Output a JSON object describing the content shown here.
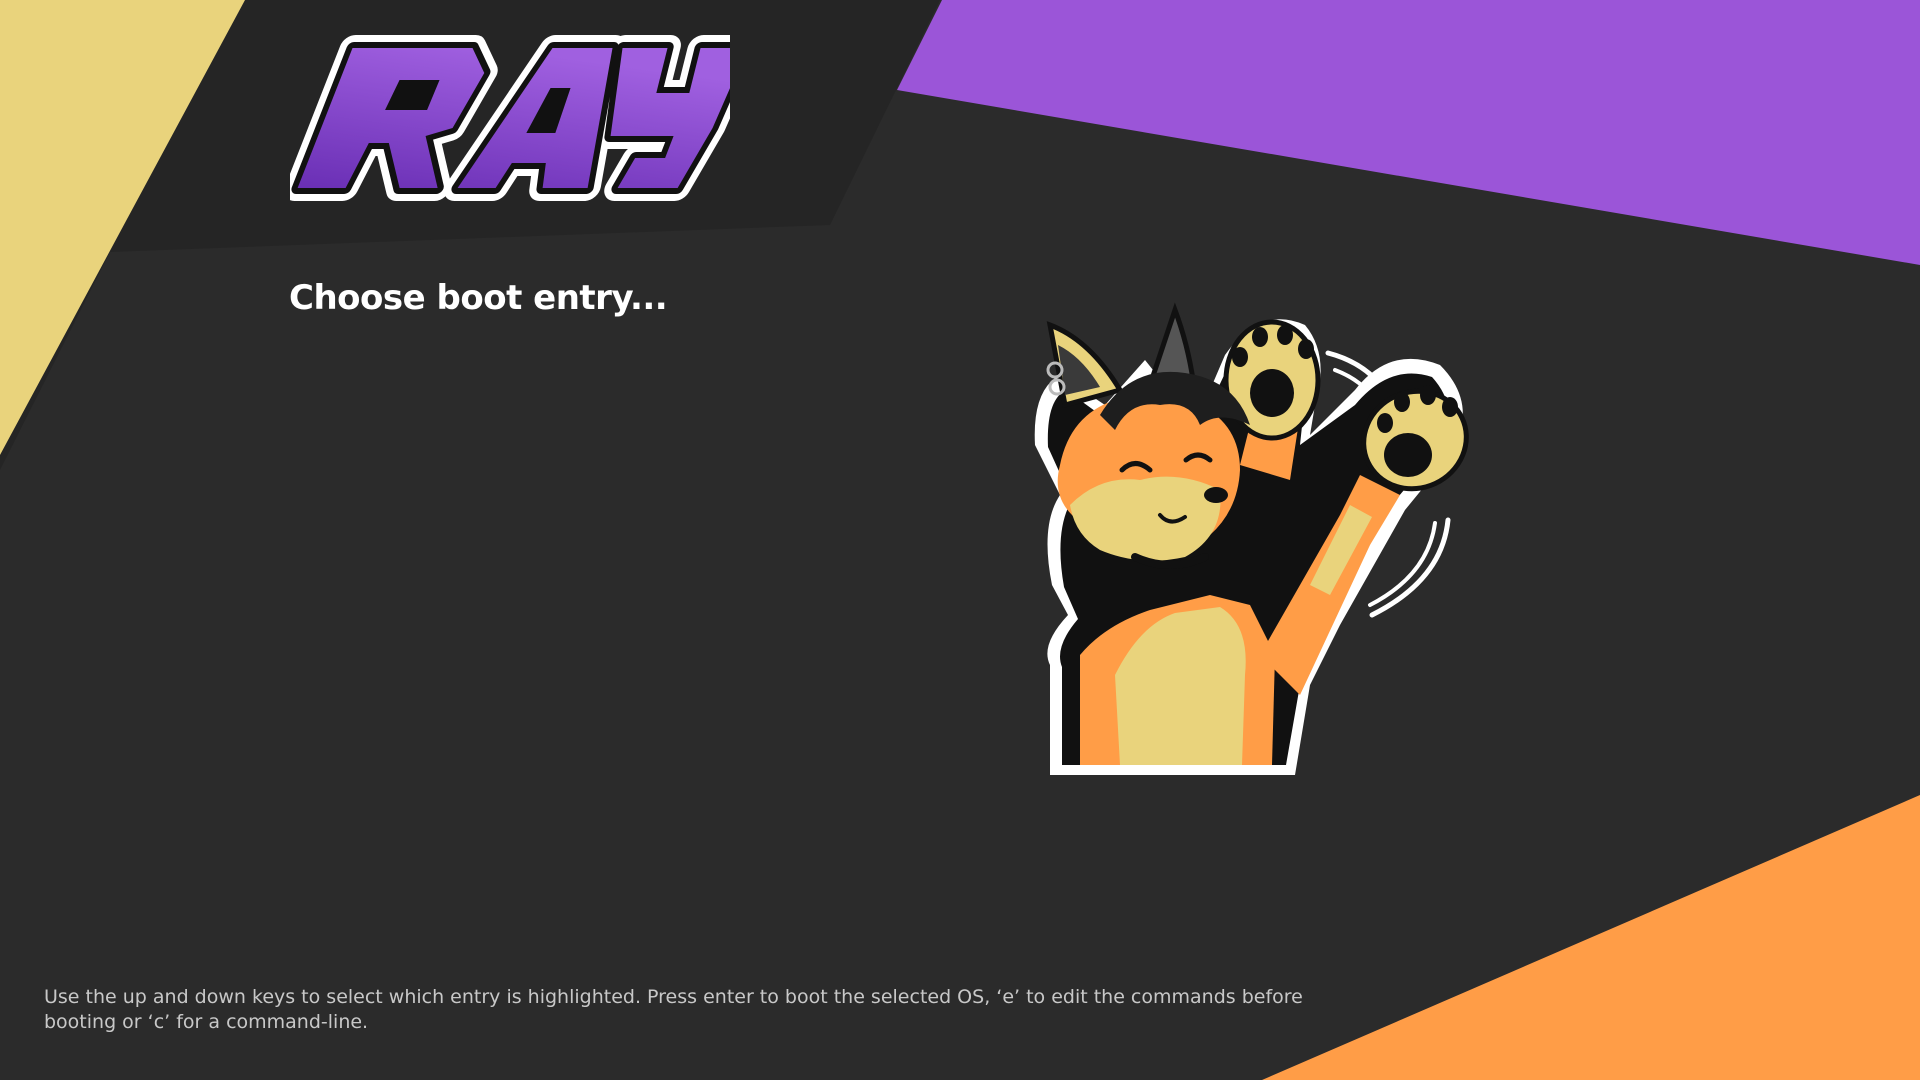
{
  "logo": {
    "text": "RAY"
  },
  "menu": {
    "title": "Choose boot entry...",
    "entries": []
  },
  "mascot": {
    "name": "fox-mascot"
  },
  "help": {
    "text": "Use the up and down keys to select which entry is highlighted. Press enter to boot the selected OS, ‘e’ to edit the commands before booting or ‘c’ for a command-line."
  },
  "colors": {
    "background": "#2b2b2b",
    "header_band": "#252525",
    "accent_yellow": "#e9d37c",
    "accent_purple": "#9b55d8",
    "accent_orange": "#ff9d47",
    "text_primary": "#ffffff",
    "text_secondary": "#c8c8c8"
  }
}
